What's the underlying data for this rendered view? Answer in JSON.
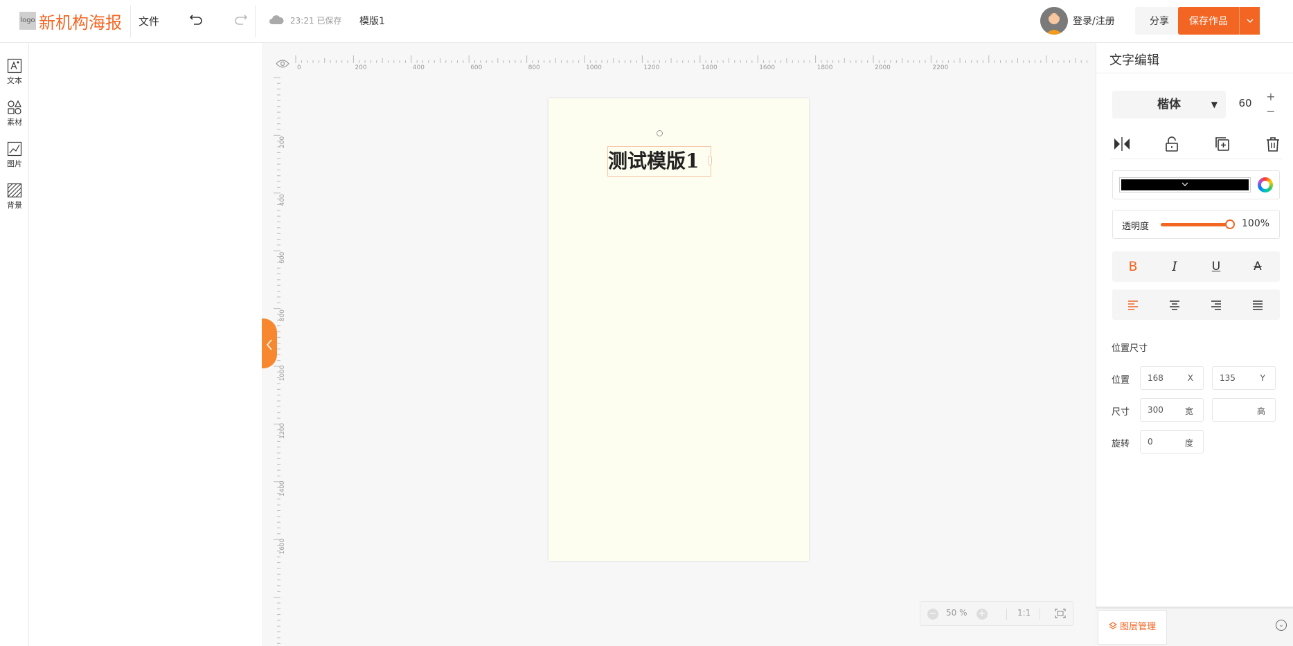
{
  "header": {
    "logo_text": "logo",
    "brand": "新机构海报",
    "file_menu": "文件",
    "save_status": "23:21 已保存",
    "doc_name": "模版1",
    "login": "登录/注册",
    "share": "分享",
    "save_work": "保存作品"
  },
  "rail": {
    "items": [
      {
        "label": "文本",
        "icon": "text-icon"
      },
      {
        "label": "素材",
        "icon": "shapes-icon"
      },
      {
        "label": "图片",
        "icon": "image-icon"
      },
      {
        "label": "背景",
        "icon": "background-icon"
      }
    ]
  },
  "rulers": {
    "top_labels": [
      "0",
      "200",
      "400",
      "600",
      "800",
      "1000",
      "1200",
      "1400",
      "1600",
      "1800",
      "2000",
      "2200"
    ],
    "left_labels": [
      "200",
      "400",
      "600",
      "800",
      "1000",
      "1200",
      "1400",
      "1600"
    ]
  },
  "canvas": {
    "text_element": "测试模版1",
    "poster_bg": "#fefef0"
  },
  "zoom": {
    "value": "50 %",
    "minus": "−",
    "plus": "+",
    "one_to_one": "1:1"
  },
  "editor": {
    "title": "文字编辑",
    "font_family": "楷体",
    "font_size": "60",
    "opacity_label": "透明度",
    "opacity_value": "100%",
    "opacity_fraction": 1.0,
    "text_color": "#000000",
    "accent_color": "#f26522",
    "style_buttons": [
      "B",
      "I",
      "U",
      "A"
    ],
    "position_title": "位置尺寸",
    "position_label": "位置",
    "size_label": "尺寸",
    "rotate_label": "旋转",
    "pos_x": "168",
    "pos_x_unit": "X",
    "pos_y": "135",
    "pos_y_unit": "Y",
    "width": "300",
    "width_unit": "宽",
    "height": "",
    "height_unit": "高",
    "rotation": "0",
    "rotation_unit": "度"
  },
  "bottom": {
    "layers_tab": "图层管理"
  }
}
